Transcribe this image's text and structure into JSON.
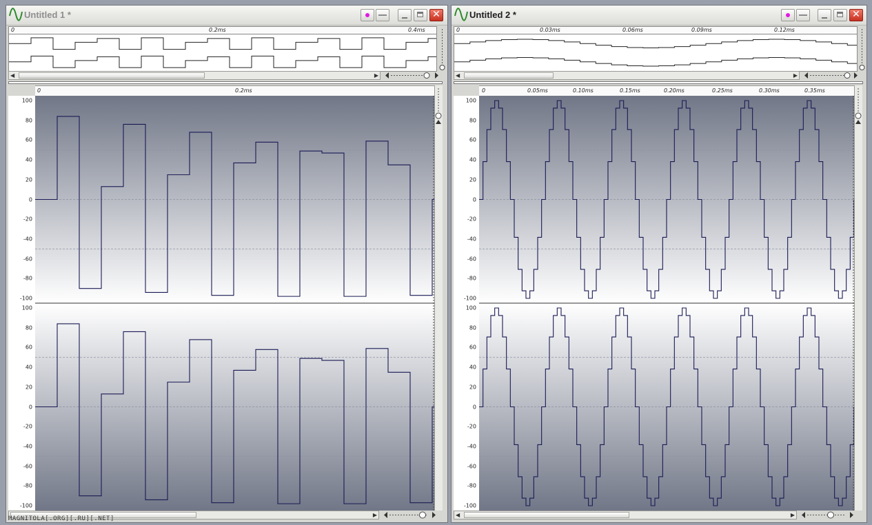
{
  "colors": {
    "wave": "#1a1a55",
    "plot_top": "#717787",
    "plot_mid": "#ffffff",
    "close": "#c8301f",
    "record": "#e01ae0"
  },
  "windows": [
    {
      "id": "w1",
      "title": "Untitled 1 *",
      "overview_time_labels": [
        "0",
        "0.2ms",
        "0.4ms"
      ],
      "main_time_labels": [
        "0",
        "0.2ms"
      ],
      "y_labels": [
        "100",
        "80",
        "60",
        "40",
        "20",
        "0",
        "-20",
        "-40",
        "-60",
        "-80",
        "-100"
      ],
      "wave_type": "square",
      "channel_icon": "waveform-icon"
    },
    {
      "id": "w2",
      "title": "Untitled 2 *",
      "overview_time_labels": [
        "0",
        "0.03ms",
        "0.06ms",
        "0.09ms",
        "0.12ms"
      ],
      "main_time_labels": [
        "0",
        "0.05ms",
        "0.10ms",
        "0.15ms",
        "0.20ms",
        "0.25ms",
        "0.30ms",
        "0.35ms"
      ],
      "y_labels": [
        "100",
        "80",
        "60",
        "40",
        "20",
        "0",
        "-20",
        "-40",
        "-60",
        "-80",
        "-100"
      ],
      "wave_type": "sine",
      "channel_icon": "waveform-icon"
    }
  ],
  "square_steps": [
    0,
    84,
    -90,
    13,
    76,
    -94,
    25,
    68,
    -97,
    37,
    58,
    -98,
    49,
    47,
    -98,
    59,
    35,
    -97,
    0
  ],
  "sine_cycles": 6,
  "watermark": "MAGNITOLA[.ORG][.RU][.NET]"
}
